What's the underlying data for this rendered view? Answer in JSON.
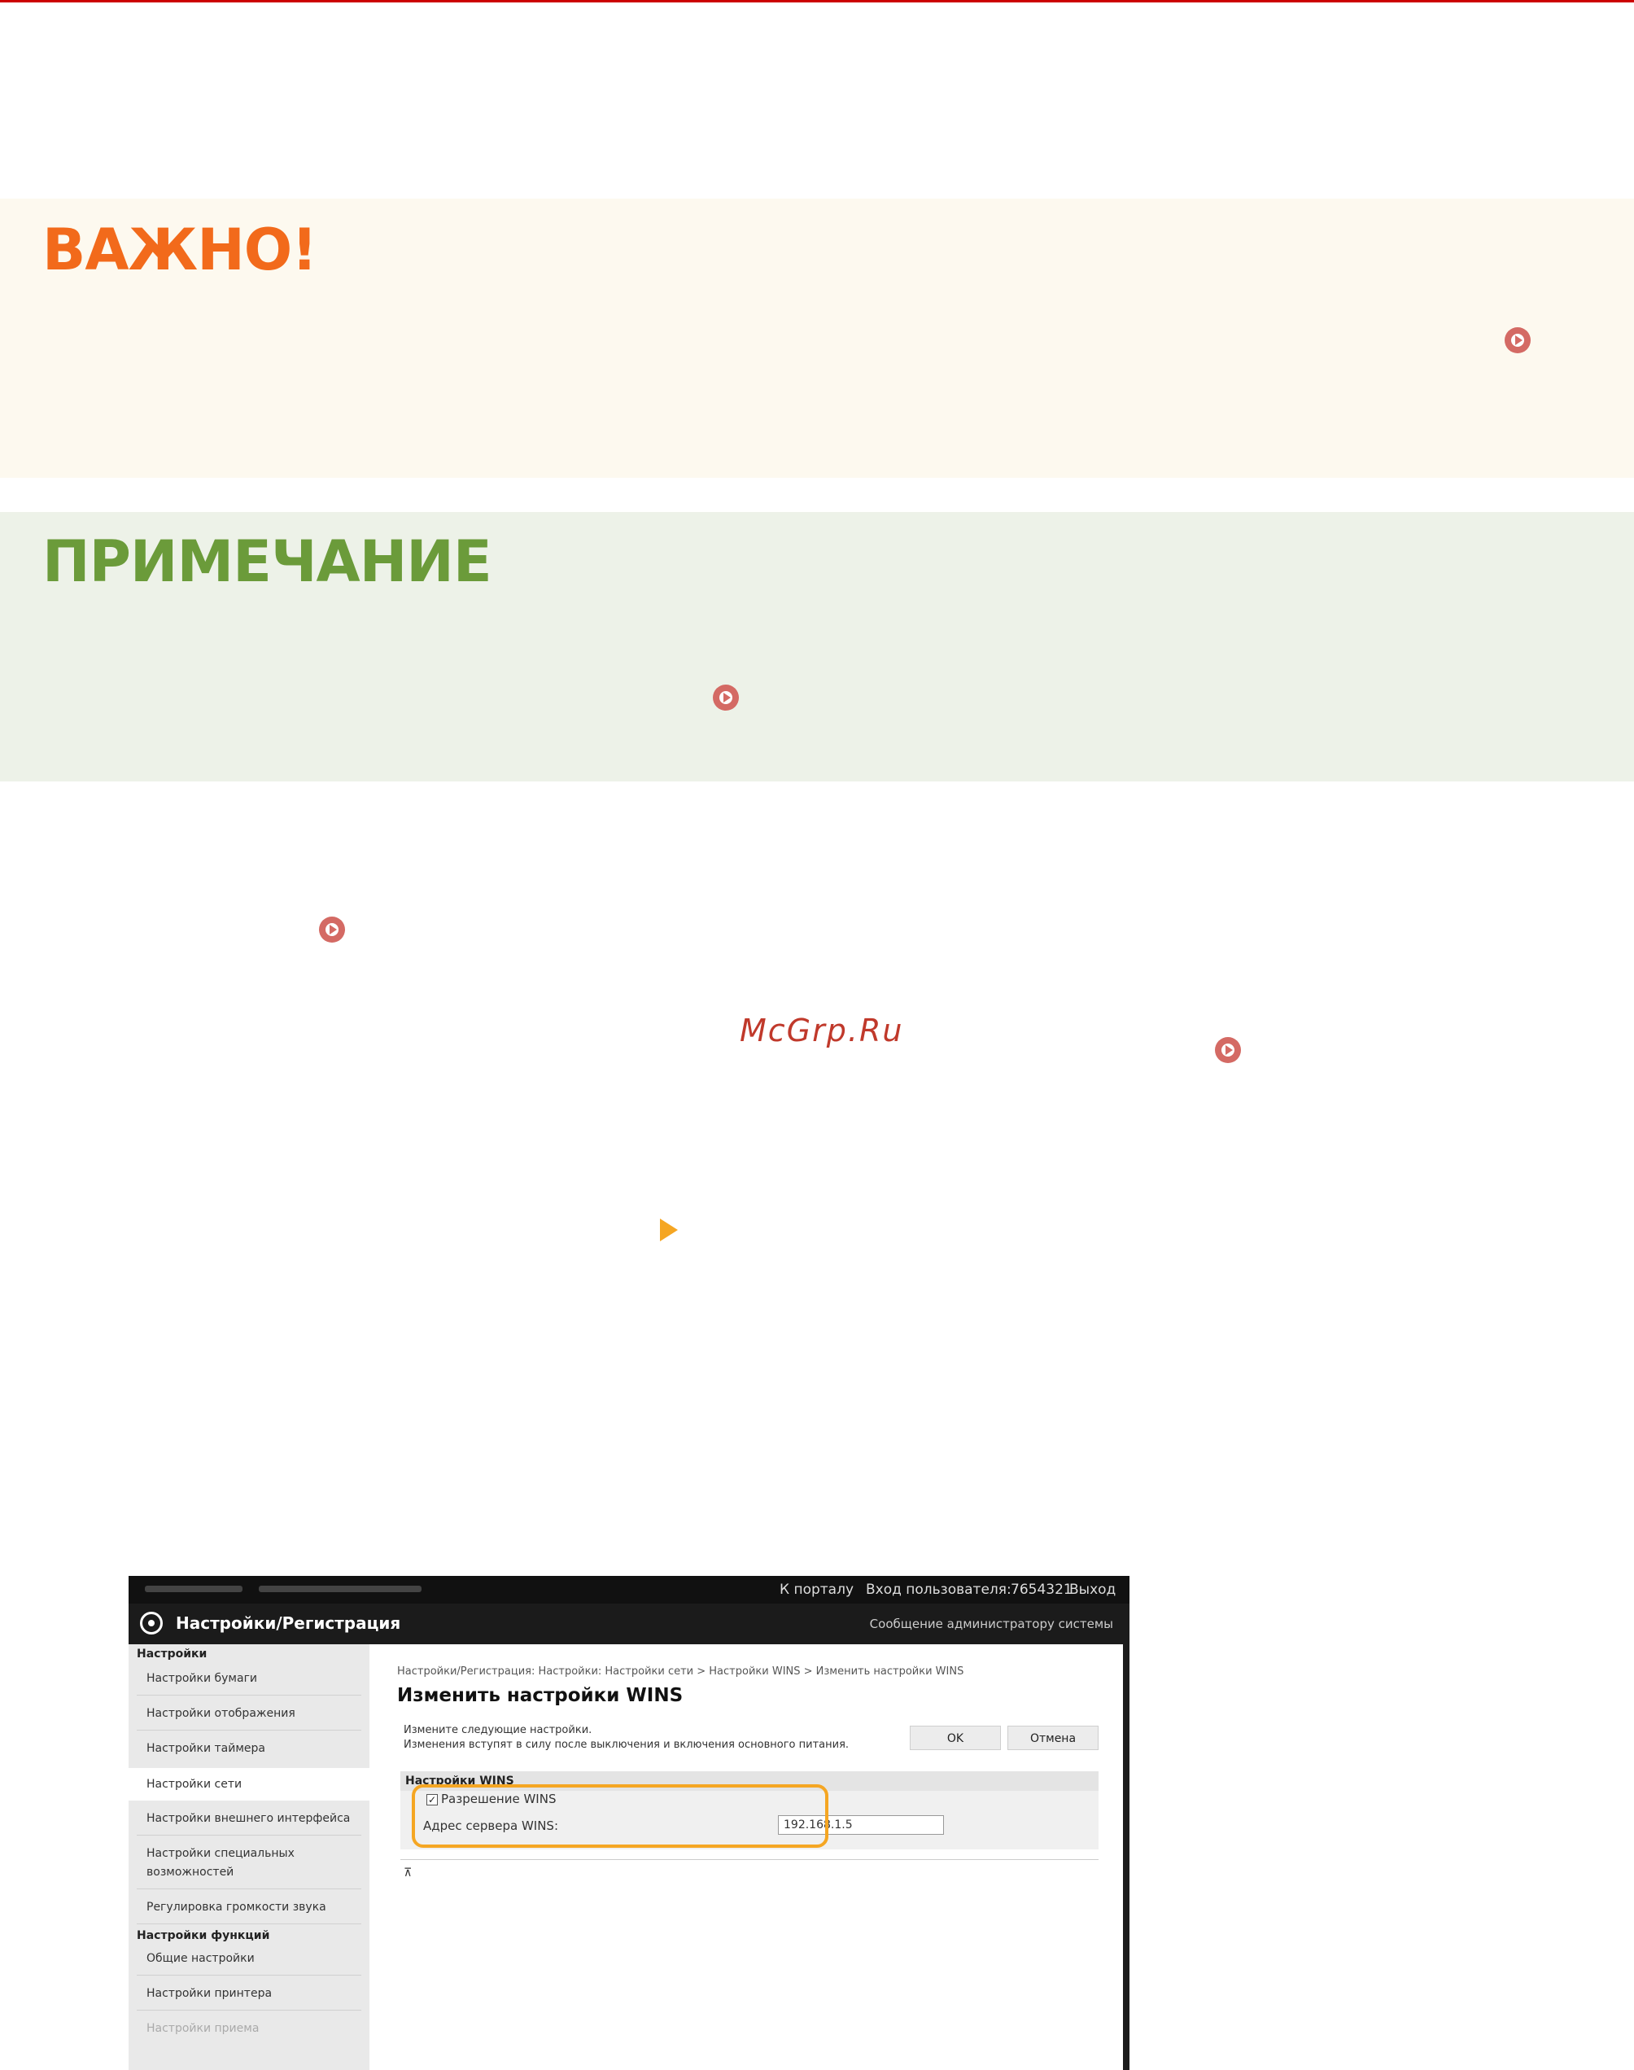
{
  "important": {
    "title": "ВАЖНО!"
  },
  "note": {
    "title": "ПРИМЕЧАНИЕ"
  },
  "watermark": "McGrp.Ru",
  "icons": {
    "link": "circle-play-icon",
    "step": "triangle-right-icon",
    "link_color": "#d46a64",
    "step_color": "#f5a623"
  },
  "remote_ui": {
    "topbar": {
      "portal_link": "К порталу",
      "login_label": "Вход пользователя:",
      "user_id": "7654321",
      "logout": "Выход"
    },
    "titlebar": {
      "title": "Настройки/Регистрация",
      "admin_message": "Сообщение администратору системы"
    },
    "sidebar": {
      "group1": "Настройки",
      "items1": [
        "Настройки бумаги",
        "Настройки отображения",
        "Настройки таймера",
        "Настройки сети",
        "Настройки внешнего интерфейса",
        "Настройки специальных",
        "возможностей",
        "Регулировка громкости звука"
      ],
      "group2": "Настройки функций",
      "items2": [
        "Общие настройки",
        "Настройки принтера",
        "Настройки приема"
      ]
    },
    "content": {
      "breadcrumb": "Настройки/Регистрация: Настройки: Настройки сети > Настройки WINS > Изменить настройки WINS",
      "page_title": "Изменить настройки WINS",
      "desc_line1": "Измените следующие настройки.",
      "desc_line2": "Изменения вступят в силу после выключения и включения основного питания.",
      "ok_label": "OK",
      "cancel_label": "Отмена",
      "section_title": "Настройки WINS",
      "wins_checkbox_label": "Разрешение WINS",
      "wins_checked_mark": "✓",
      "server_label": "Адрес сервера WINS:",
      "server_value": "192.168.1.5",
      "to_top_icon": "⊼"
    }
  }
}
